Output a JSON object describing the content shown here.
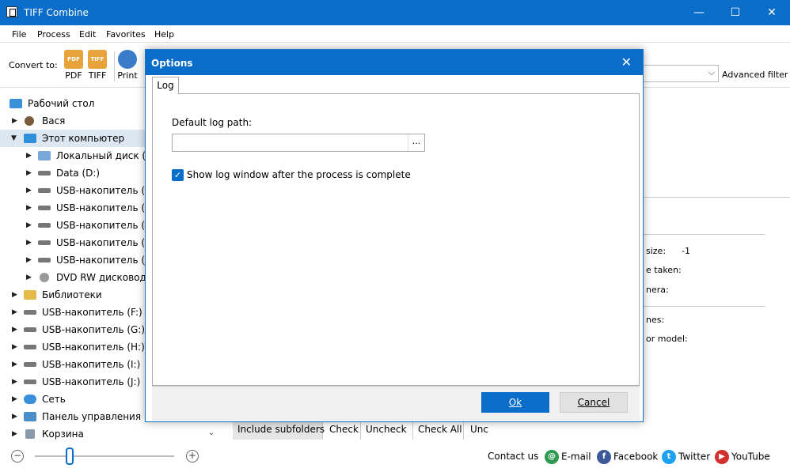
{
  "window": {
    "title": "TIFF Combine",
    "minimize": "—",
    "maximize": "☐",
    "close": "✕"
  },
  "menu": [
    "File",
    "Process",
    "Edit",
    "Favorites",
    "Help"
  ],
  "toolbar": {
    "convert_label": "Convert to:",
    "buttons": [
      {
        "label": "PDF",
        "icon": "pdf-icon",
        "text": "PDF",
        "color": "#e8a33a"
      },
      {
        "label": "TIFF",
        "icon": "tiff-icon",
        "text": "TIFF",
        "color": "#e8a33a"
      },
      {
        "label": "Print",
        "icon": "printer-icon",
        "text": "",
        "color": "#3a7cc9"
      }
    ],
    "advanced_filter": "Advanced filter"
  },
  "tree": [
    {
      "label": "Рабочий стол",
      "icon": "desktop-icon",
      "color": "#3a8fd9"
    },
    {
      "label": "Вася",
      "icon": "user-icon",
      "color": "#7a5b3a"
    },
    {
      "label": "Этот компьютер",
      "icon": "computer-icon",
      "color": "#2f8fd8"
    },
    {
      "label": "Локальный диск (C",
      "icon": "local-disk-icon",
      "color": "#7aa7d9"
    },
    {
      "label": "Data (D:)",
      "icon": "drive-icon",
      "color": "#777777"
    },
    {
      "label": "USB-накопитель (F",
      "icon": "drive-icon",
      "color": "#777777"
    },
    {
      "label": "USB-накопитель (G",
      "icon": "drive-icon",
      "color": "#777777"
    },
    {
      "label": "USB-накопитель (H",
      "icon": "drive-icon",
      "color": "#777777"
    },
    {
      "label": "USB-накопитель (I:",
      "icon": "drive-icon",
      "color": "#777777"
    },
    {
      "label": "USB-накопитель (J:",
      "icon": "drive-icon",
      "color": "#777777"
    },
    {
      "label": "DVD RW дисковод (",
      "icon": "dvd-icon",
      "color": "#999999"
    },
    {
      "label": "Библиотеки",
      "icon": "library-icon",
      "color": "#e5b94a"
    },
    {
      "label": "USB-накопитель (F:)",
      "icon": "drive-icon",
      "color": "#777777"
    },
    {
      "label": "USB-накопитель (G:)",
      "icon": "drive-icon",
      "color": "#777777"
    },
    {
      "label": "USB-накопитель (H:)",
      "icon": "drive-icon",
      "color": "#777777"
    },
    {
      "label": "USB-накопитель (I:)",
      "icon": "drive-icon",
      "color": "#777777"
    },
    {
      "label": "USB-накопитель (J:)",
      "icon": "drive-icon",
      "color": "#777777"
    },
    {
      "label": "Сеть",
      "icon": "network-icon",
      "color": "#3a8fd9"
    },
    {
      "label": "Панель управления",
      "icon": "control-panel-icon",
      "color": "#4a8fc9"
    },
    {
      "label": "Корзина",
      "icon": "recycle-bin-icon",
      "color": "#8a9aaa"
    }
  ],
  "tree_scroll": "⌄",
  "properties": {
    "size_label": "size:",
    "size_value": "-1",
    "date_taken": "e taken:",
    "camera": "nera:",
    "names": "nes:",
    "model": "or model:"
  },
  "bottom_tabs": [
    "Include subfolders",
    "Check",
    "Uncheck",
    "Check All",
    "Unc"
  ],
  "status": {
    "zoom_minus": "−",
    "zoom_plus": "+",
    "contact": "Contact us",
    "links": [
      {
        "label": "E-mail",
        "icon": "email-icon",
        "glyph": "@",
        "color": "#2f9a4f"
      },
      {
        "label": "Facebook",
        "icon": "facebook-icon",
        "glyph": "f",
        "color": "#3b5998"
      },
      {
        "label": "Twitter",
        "icon": "twitter-icon",
        "glyph": "t",
        "color": "#1da1f2"
      },
      {
        "label": "YouTube",
        "icon": "youtube-icon",
        "glyph": "▶",
        "color": "#d32f2f"
      }
    ]
  },
  "dialog": {
    "title": "Options",
    "close": "✕",
    "tab": "Log",
    "path_label": "Default log path:",
    "path_value": "",
    "browse": "...",
    "checkbox_label": "Show log window after the process is complete",
    "checkbox_checked": true,
    "ok": "Ok",
    "cancel": "Cancel"
  }
}
